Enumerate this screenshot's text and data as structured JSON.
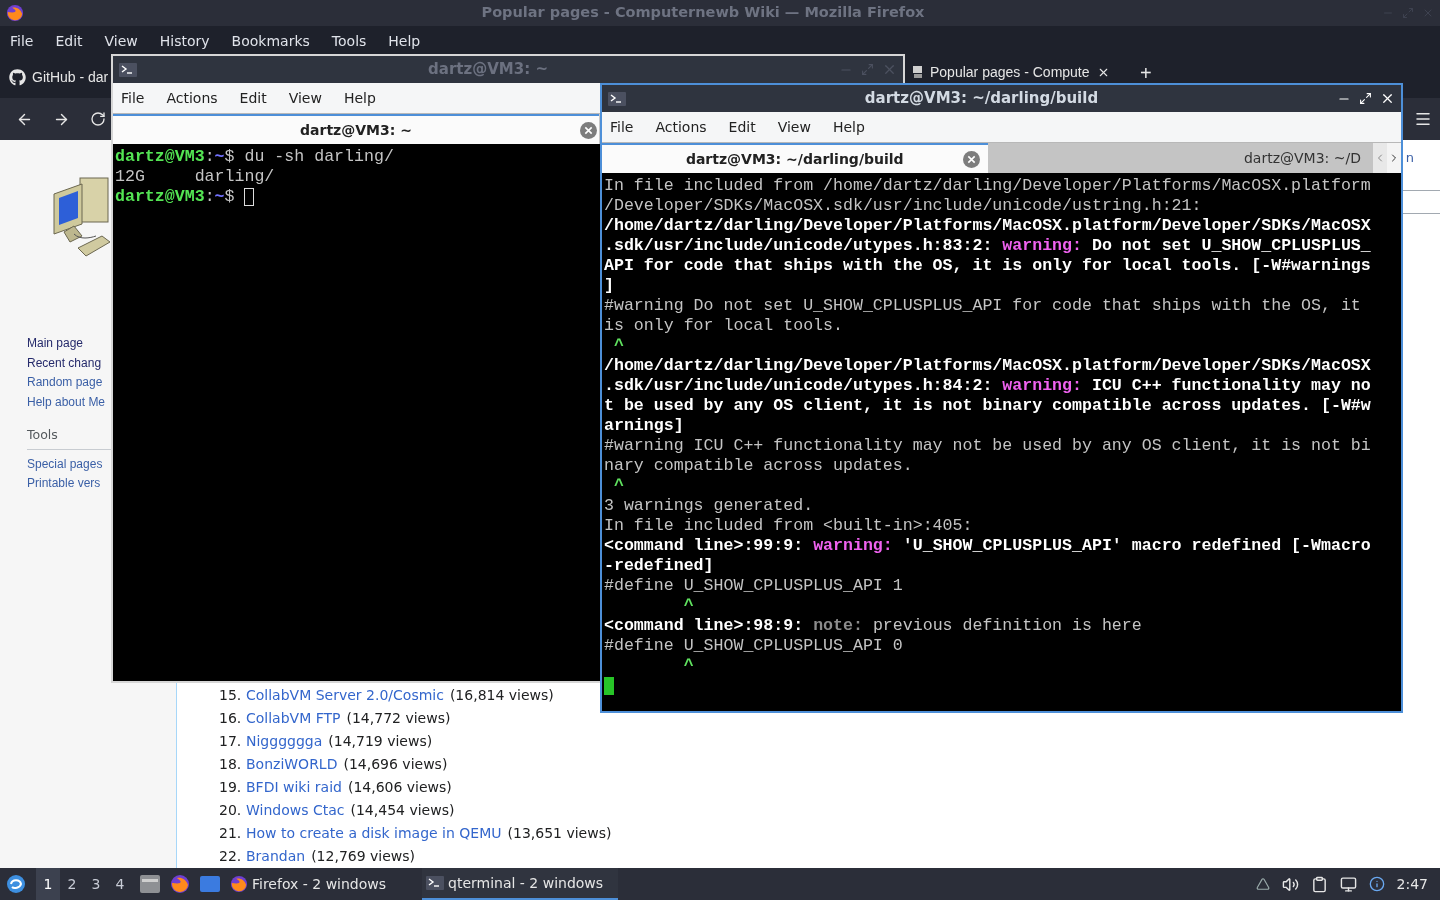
{
  "firefox": {
    "title": "Popular pages - Computernewb Wiki — Mozilla Firefox",
    "menu": [
      "File",
      "Edit",
      "View",
      "History",
      "Bookmarks",
      "Tools",
      "Help"
    ],
    "tabs": [
      {
        "label": "GitHub - dar",
        "selected": false
      },
      {
        "label": "Popular pages - Compute",
        "selected": true
      }
    ],
    "new_tab": "+",
    "header_fragment": "n",
    "sidebar": {
      "navigation": [
        {
          "label": "Main page",
          "visited": true
        },
        {
          "label": "Recent chang",
          "visited": true
        },
        {
          "label": "Random page",
          "visited": false
        },
        {
          "label": "Help about Me",
          "visited": false
        }
      ],
      "tools_heading": "Tools",
      "tools": [
        {
          "label": "Special pages",
          "visited": false
        },
        {
          "label": "Printable vers",
          "visited": false
        }
      ]
    },
    "popular": [
      {
        "rank": "15.",
        "title": "CollabVM Server 2.0/Cosmic",
        "views": "(16,814 views)"
      },
      {
        "rank": "16.",
        "title": "CollabVM FTP",
        "views": "(14,772 views)"
      },
      {
        "rank": "17.",
        "title": "Nigggggga",
        "views": "(14,719 views)"
      },
      {
        "rank": "18.",
        "title": "BonziWORLD",
        "views": "(14,696 views)"
      },
      {
        "rank": "19.",
        "title": "BFDI wiki raid",
        "views": "(14,606 views)"
      },
      {
        "rank": "20.",
        "title": "Windows Ctac",
        "views": "(14,454 views)"
      },
      {
        "rank": "21.",
        "title": "How to create a disk image in QEMU",
        "views": "(13,651 views)"
      },
      {
        "rank": "22.",
        "title": "Brandan",
        "views": "(12,769 views)"
      }
    ]
  },
  "terminals": [
    {
      "title": "dartz@VM3: ~",
      "focused": false,
      "menu": [
        "File",
        "Actions",
        "Edit",
        "View",
        "Help"
      ],
      "tabs": [
        {
          "label": "dartz@VM3: ~",
          "selected": true
        }
      ],
      "lines": [
        [
          {
            "kind": "user",
            "text": "dartz@VM3"
          },
          {
            "kind": "plain",
            "text": ":"
          },
          {
            "kind": "path",
            "text": "~"
          },
          {
            "kind": "plain",
            "text": "$ du -sh darling/"
          }
        ],
        [
          {
            "kind": "plain",
            "text": "12G     darling/"
          }
        ],
        [
          {
            "kind": "user",
            "text": "dartz@VM3"
          },
          {
            "kind": "plain",
            "text": ":"
          },
          {
            "kind": "path",
            "text": "~"
          },
          {
            "kind": "plain",
            "text": "$ "
          },
          {
            "kind": "cursor"
          }
        ]
      ]
    },
    {
      "title": "dartz@VM3: ~/darling/build",
      "focused": true,
      "menu": [
        "File",
        "Actions",
        "Edit",
        "View",
        "Help"
      ],
      "tabs": [
        {
          "label": "dartz@VM3: ~/darling/build",
          "selected": true
        },
        {
          "label": "dartz@VM3: ~/D",
          "selected": false
        }
      ],
      "lines": [
        [
          {
            "kind": "plain",
            "text": "In file included from /home/dartz/darling/Developer/Platforms/MacOSX.platform"
          }
        ],
        [
          {
            "kind": "plain",
            "text": "/Developer/SDKs/MacOSX.sdk/usr/include/unicode/ustring.h:21:"
          }
        ],
        [
          {
            "kind": "bold",
            "text": "/home/dartz/darling/Developer/Platforms/MacOSX.platform/Developer/SDKs/MacOSX"
          }
        ],
        [
          {
            "kind": "bold",
            "text": ".sdk/usr/include/unicode/utypes.h:83:2: "
          },
          {
            "kind": "warning",
            "text": "warning:"
          },
          {
            "kind": "bold",
            "text": " Do not set U_SHOW_CPLUSPLUS_"
          }
        ],
        [
          {
            "kind": "bold",
            "text": "API for code that ships with the OS, it is only for local tools. [-W#warnings"
          }
        ],
        [
          {
            "kind": "bold",
            "text": "]"
          }
        ],
        [
          {
            "kind": "plain",
            "text": "#warning Do not set U_SHOW_CPLUSPLUS_API for code that ships with the OS, it"
          }
        ],
        [
          {
            "kind": "plain",
            "text": "is only for local tools."
          }
        ],
        [
          {
            "kind": "caret",
            "text": " ^"
          }
        ],
        [
          {
            "kind": "bold",
            "text": "/home/dartz/darling/Developer/Platforms/MacOSX.platform/Developer/SDKs/MacOSX"
          }
        ],
        [
          {
            "kind": "bold",
            "text": ".sdk/usr/include/unicode/utypes.h:84:2: "
          },
          {
            "kind": "warning",
            "text": "warning:"
          },
          {
            "kind": "bold",
            "text": " ICU C++ functionality may no"
          }
        ],
        [
          {
            "kind": "bold",
            "text": "t be used by any OS client, it is not binary compatible across updates. [-W#w"
          }
        ],
        [
          {
            "kind": "bold",
            "text": "arnings]"
          }
        ],
        [
          {
            "kind": "plain",
            "text": "#warning ICU C++ functionality may not be used by any OS client, it is not bi"
          }
        ],
        [
          {
            "kind": "plain",
            "text": "nary compatible across updates."
          }
        ],
        [
          {
            "kind": "caret",
            "text": " ^"
          }
        ],
        [
          {
            "kind": "plain",
            "text": "3 warnings generated."
          }
        ],
        [
          {
            "kind": "plain",
            "text": "In file included from <built-in>:405:"
          }
        ],
        [
          {
            "kind": "bold",
            "text": "<command line>:99:9: "
          },
          {
            "kind": "warning",
            "text": "warning:"
          },
          {
            "kind": "bold",
            "text": " 'U_SHOW_CPLUSPLUS_API' macro redefined [-Wmacro"
          }
        ],
        [
          {
            "kind": "bold",
            "text": "-redefined]"
          }
        ],
        [
          {
            "kind": "plain",
            "text": "#define U_SHOW_CPLUSPLUS_API 1"
          }
        ],
        [
          {
            "kind": "caret",
            "text": "        ^"
          }
        ],
        [
          {
            "kind": "bold",
            "text": "<command line>:98:9: "
          },
          {
            "kind": "note",
            "text": "note:"
          },
          {
            "kind": "plain",
            "text": " previous definition is here"
          }
        ],
        [
          {
            "kind": "plain",
            "text": "#define U_SHOW_CPLUSPLUS_API 0"
          }
        ],
        [
          {
            "kind": "caret",
            "text": "        ^"
          }
        ],
        [
          {
            "kind": "cursor"
          }
        ]
      ]
    }
  ],
  "taskbar": {
    "workspaces": [
      {
        "label": "1",
        "selected": true
      },
      {
        "label": "2",
        "selected": false
      },
      {
        "label": "3",
        "selected": false
      },
      {
        "label": "4",
        "selected": false
      }
    ],
    "tasks": [
      {
        "kind": "browser",
        "label": "Firefox - 2 windows",
        "selected": false
      },
      {
        "kind": "terminal",
        "label": "qterminal - 2 windows",
        "selected": true
      }
    ],
    "clock": "2:47"
  }
}
